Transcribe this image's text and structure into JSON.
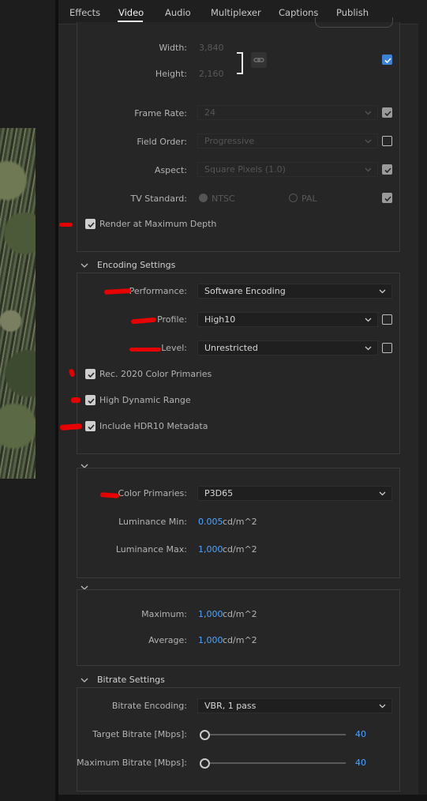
{
  "tabs": [
    "Effects",
    "Video",
    "Audio",
    "Multiplexer",
    "Captions",
    "Publish"
  ],
  "active_tab": "Video",
  "video_basic": {
    "width_label": "Width:",
    "width_value": "3,840",
    "height_label": "Height:",
    "height_value": "2,160",
    "frame_rate_label": "Frame Rate:",
    "frame_rate_value": "24",
    "field_order_label": "Field Order:",
    "field_order_value": "Progressive",
    "aspect_label": "Aspect:",
    "aspect_value": "Square Pixels (1.0)",
    "tv_standard_label": "TV Standard:",
    "ntsc_label": "NTSC",
    "pal_label": "PAL",
    "render_max_depth_label": "Render at Maximum Depth"
  },
  "encoding": {
    "section_title": "Encoding Settings",
    "performance_label": "Performance:",
    "performance_value": "Software Encoding",
    "profile_label": "Profile:",
    "profile_value": "High10",
    "level_label": "Level:",
    "level_value": "Unrestricted",
    "rec2020_label": "Rec. 2020 Color Primaries",
    "hdr_label": "High Dynamic Range",
    "hdr10_label": "Include HDR10 Metadata"
  },
  "hdr_metadata": {
    "color_primaries_label": "Color Primaries:",
    "color_primaries_value": "P3D65",
    "lum_min_label": "Luminance Min:",
    "lum_min_value": "0.005",
    "lum_min_unit": "cd/m^2",
    "lum_max_label": "Luminance Max:",
    "lum_max_value": "1,000",
    "lum_max_unit": "cd/m^2"
  },
  "content_light": {
    "maximum_label": "Maximum:",
    "maximum_value": "1,000",
    "maximum_unit": "cd/m^2",
    "average_label": "Average:",
    "average_value": "1,000",
    "average_unit": "cd/m^2"
  },
  "bitrate": {
    "section_title": "Bitrate Settings",
    "encoding_label": "Bitrate Encoding:",
    "encoding_value": "VBR, 1 pass",
    "target_label": "Target Bitrate [Mbps]:",
    "target_value": "40",
    "max_label": "Maximum Bitrate [Mbps]:",
    "max_value": "40"
  },
  "colors": {
    "accent_blue": "#4da3ff",
    "annotation_red": "#e60000",
    "panel": "#262626"
  }
}
